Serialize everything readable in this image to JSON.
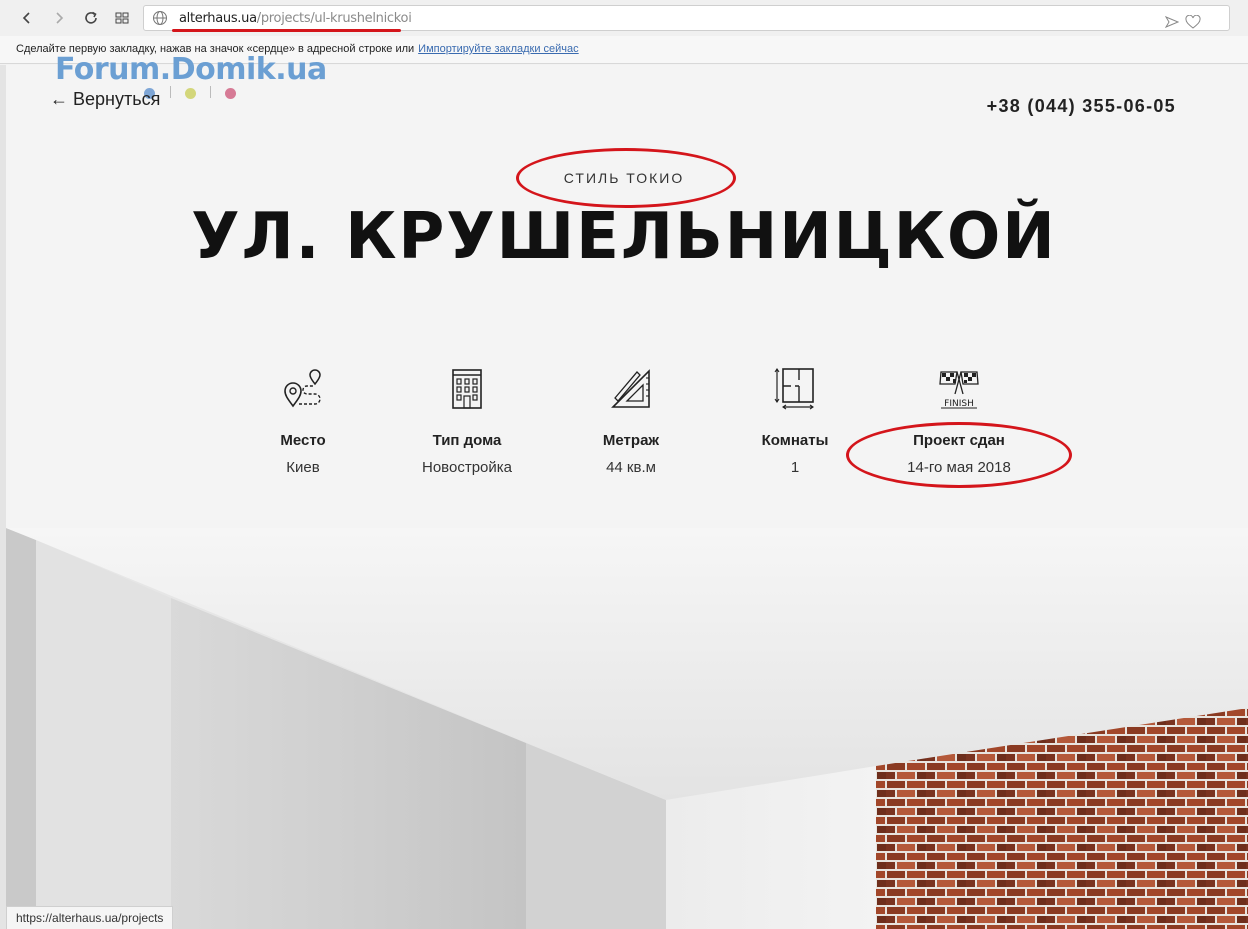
{
  "browser": {
    "url_domain": "alterhaus.ua",
    "url_path": "/projects/ul-krushelnickoi",
    "bookmarks_prompt": "Сделайте первую закладку, нажав на значок «сердце» в адресной строке или",
    "bookmarks_import_link": "Импортируйте закладки сейчас",
    "status_url": "https://alterhaus.ua/projects"
  },
  "watermark": {
    "text": "Forum.Domik.ua"
  },
  "header": {
    "back_link": "← Вернуться",
    "phone": "+38 (044) 355-06-05"
  },
  "project": {
    "style": "СТИЛЬ ТОКИО",
    "title": "УЛ. КРУШЕЛЬНИЦКОЙ"
  },
  "stats": [
    {
      "icon": "map-route-icon",
      "label": "Место",
      "value": "Киев"
    },
    {
      "icon": "building-icon",
      "label": "Тип дома",
      "value": "Новостройка"
    },
    {
      "icon": "ruler-triangle-icon",
      "label": "Метраж",
      "value": "44 кв.м"
    },
    {
      "icon": "floor-plan-icon",
      "label": "Комнаты",
      "value": "1"
    },
    {
      "icon": "finish-flags-icon",
      "label": "Проект сдан",
      "value": "14-го мая 2018",
      "finish_text": "FINISH"
    }
  ],
  "colors": {
    "annotation_red": "#d4151b",
    "watermark_blue": "#6b9fd3",
    "link_blue": "#3a6bb0",
    "dot_blue": "#7ea6d6",
    "dot_green": "#d3d67a",
    "dot_pink": "#d67a95"
  }
}
